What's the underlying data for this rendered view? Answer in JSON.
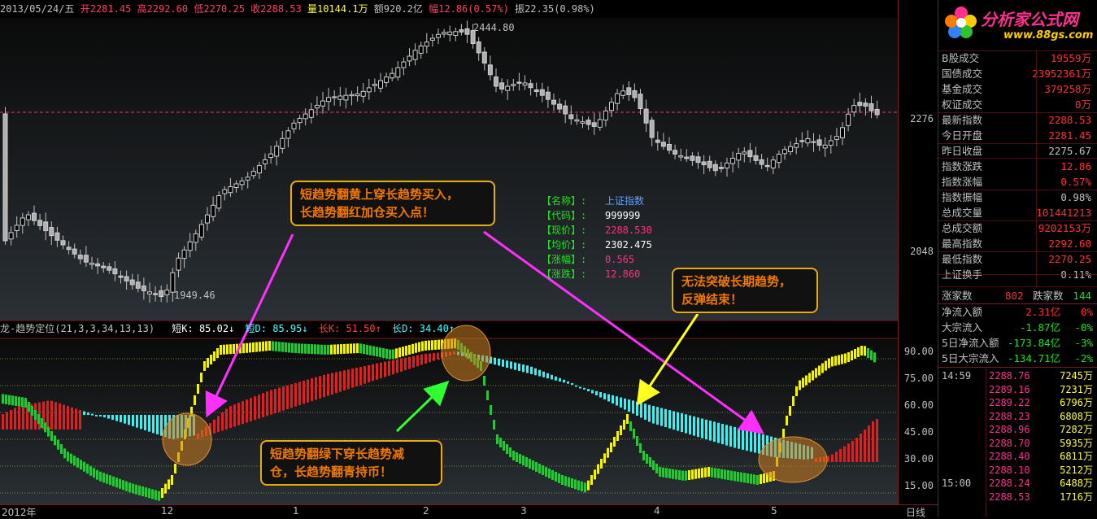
{
  "topbar": {
    "date": "2013/05/24/五",
    "open": "开2281.45",
    "high": "高2292.60",
    "low": "低2270.25",
    "close": "收2288.53",
    "volume": "量10144.1万",
    "amount": "额920.2亿",
    "change_pct": "幅12.86(0.57%)",
    "amplitude": "振22.35(0.98%)",
    "markers": "×××××"
  },
  "price_chart": {
    "high_label": "2444.80",
    "low_label": "1949.46",
    "y_labels": [
      "2276",
      "2048"
    ],
    "ref_line_value": 2276
  },
  "indicator": {
    "name": "龙-趋势定位(21,3,3,34,13,13)",
    "short_k": "短K: 85.02↓",
    "short_d": "短D: 85.95↓",
    "long_k": "长K: 51.50↑",
    "long_d": "长D: 34.40↑",
    "y_labels": [
      "90.00",
      "75.00",
      "60.00",
      "45.00",
      "30.00",
      "15.00"
    ]
  },
  "x_labels": [
    "2012年",
    "12",
    "1",
    "2",
    "3",
    "4",
    "5",
    "日线"
  ],
  "callouts": {
    "buy": [
      "短趋势翻黄上穿长趋势买入，",
      "长趋势翻红加仓买入点！"
    ],
    "sell": [
      "短趋势翻绿下穿长趋势减",
      "仓，长趋势翻青持币！"
    ],
    "fail": [
      "无法突破长期趋势，",
      "反弹结束！"
    ]
  },
  "info_box": {
    "rows": [
      {
        "k": "【名称】:",
        "v": "上证指数",
        "color": "#60a0ff"
      },
      {
        "k": "【代码】:",
        "v": "999999",
        "color": "#ffffff"
      },
      {
        "k": "【现价】:",
        "v": "2288.530",
        "color": "#ff3080"
      },
      {
        "k": "【均价】:",
        "v": "2302.475",
        "color": "#ffffff"
      },
      {
        "k": "【涨幅】:",
        "v": "0.565",
        "color": "#ff3080"
      },
      {
        "k": "【涨跌】:",
        "v": "12.860",
        "color": "#ff3080"
      }
    ]
  },
  "logo": {
    "title": "分析家公式网",
    "url": "www.88gs.com"
  },
  "right_panel": {
    "stats": [
      {
        "label": "B股成交",
        "value": "19559万",
        "color": "#ff3030"
      },
      {
        "label": "国债成交",
        "value": "23952361万",
        "color": "#ff3030"
      },
      {
        "label": "基金成交",
        "value": "379258万",
        "color": "#ff3030"
      },
      {
        "label": "权证成交",
        "value": "0万",
        "color": "#ff3030"
      },
      {
        "label": "最新指数",
        "value": "2288.53",
        "color": "#ff3030"
      },
      {
        "label": "今日开盘",
        "value": "2281.45",
        "color": "#ff3030"
      },
      {
        "label": "昨日收盘",
        "value": "2275.67",
        "color": "#c0c0c0"
      },
      {
        "label": "指数涨跌",
        "value": "12.86",
        "color": "#ff3030"
      },
      {
        "label": "指数涨幅",
        "value": "0.57%",
        "color": "#ff3030"
      },
      {
        "label": "指数振幅",
        "value": "0.98%",
        "color": "#c0c0c0"
      },
      {
        "label": "总成交量",
        "value": "101441213",
        "color": "#ff3030"
      },
      {
        "label": "总成交额",
        "value": "9202153万",
        "color": "#ff3030"
      },
      {
        "label": "最高指数",
        "value": "2292.60",
        "color": "#ff3030"
      },
      {
        "label": "最低指数",
        "value": "2270.25",
        "color": "#ff3030"
      },
      {
        "label": "上证换手",
        "value": "0.11%",
        "color": "#c0c0c0"
      }
    ],
    "updown": {
      "up_label": "涨家数",
      "up": "802",
      "down_label": "跌家数",
      "down": "144"
    },
    "flows": [
      {
        "label": "净流入额",
        "value": "2.31亿",
        "pct": "0%",
        "color": "#ff3030"
      },
      {
        "label": "大宗流入",
        "value": "-1.87亿",
        "pct": "-0%",
        "color": "#20e020"
      },
      {
        "label": "5日净流入额",
        "value": "-173.84亿",
        "pct": "-3%",
        "color": "#20e020"
      },
      {
        "label": "5日大宗流入",
        "value": "-134.71亿",
        "pct": "-2%",
        "color": "#20e020"
      }
    ],
    "ticks": [
      {
        "time": "14:59",
        "price": "2288.76",
        "vol": "7245万"
      },
      {
        "time": "",
        "price": "2289.16",
        "vol": "7231万"
      },
      {
        "time": "",
        "price": "2289.22",
        "vol": "6796万"
      },
      {
        "time": "",
        "price": "2288.23",
        "vol": "6808万"
      },
      {
        "time": "",
        "price": "2288.96",
        "vol": "7282万"
      },
      {
        "time": "",
        "price": "2288.70",
        "vol": "5935万"
      },
      {
        "time": "",
        "price": "2288.40",
        "vol": "6811万"
      },
      {
        "time": "",
        "price": "2288.10",
        "vol": "5212万"
      },
      {
        "time": "15:00",
        "price": "2288.24",
        "vol": "6488万"
      },
      {
        "time": "",
        "price": "2288.53",
        "vol": "1716万"
      }
    ]
  }
}
